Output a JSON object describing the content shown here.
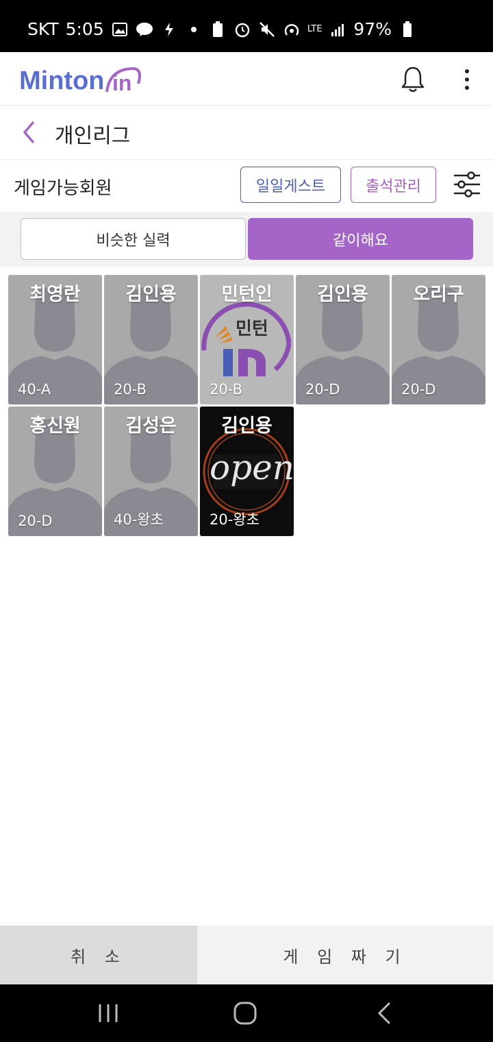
{
  "status_bar": {
    "carrier": "SKT",
    "time": "5:05",
    "network": "LTE",
    "battery": "97%"
  },
  "app": {
    "logo_text": "Minton in",
    "brand_color": "#a565c8",
    "logo_blue": "#5a6fd0"
  },
  "header": {
    "title": "개인리그"
  },
  "section": {
    "title": "게임가능회원",
    "guest_button": "일일게스트",
    "attendance_button": "출석관리"
  },
  "tabs": [
    {
      "label": "비슷한 실력",
      "active": false
    },
    {
      "label": "같이해요",
      "active": true
    }
  ],
  "members": [
    {
      "name": "최영란",
      "grade": "40-A",
      "photo": "default-avatar"
    },
    {
      "name": "김인용",
      "grade": "20-B",
      "photo": "default-avatar"
    },
    {
      "name": "민턴인",
      "grade": "20-B",
      "photo": "minton-logo",
      "logo_text": "민턴"
    },
    {
      "name": "김인용",
      "grade": "20-D",
      "photo": "default-avatar"
    },
    {
      "name": "오리구",
      "grade": "20-D",
      "photo": "default-avatar"
    },
    {
      "name": "홍신원",
      "grade": "20-D",
      "photo": "default-avatar"
    },
    {
      "name": "김성은",
      "grade": "40-왕초",
      "photo": "default-avatar"
    },
    {
      "name": "김인용",
      "grade": "20-왕초",
      "photo": "open-sign",
      "sign_text": "open"
    }
  ],
  "footer": {
    "cancel_label": "취 소",
    "make_game_label": "게 임 짜 기"
  }
}
